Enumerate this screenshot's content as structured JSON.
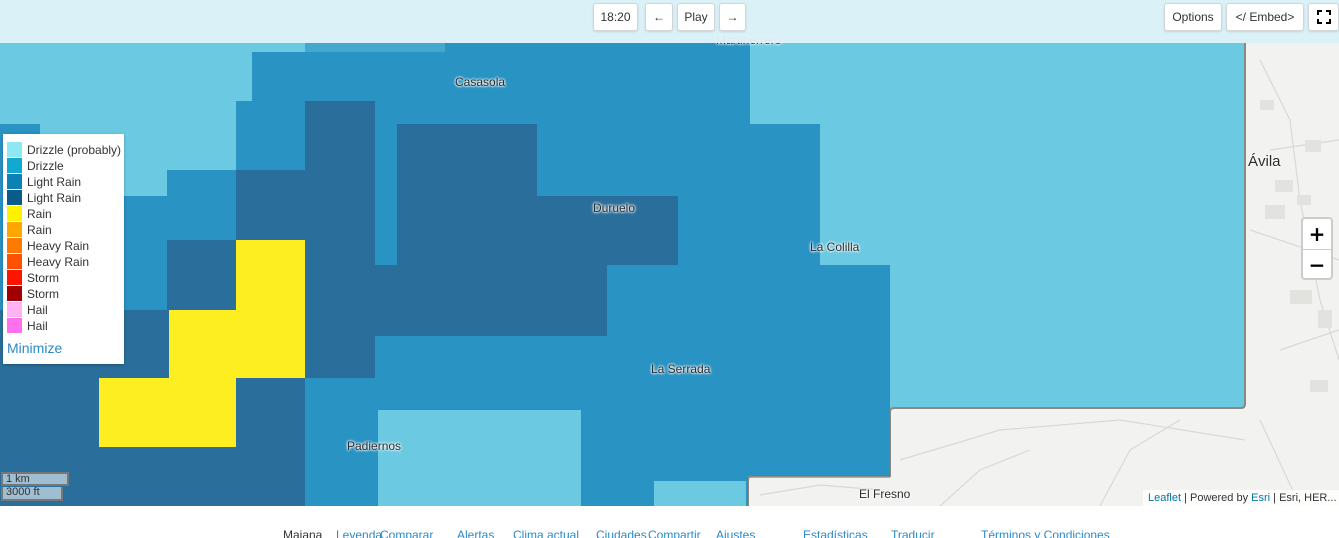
{
  "toolbar": {
    "time": "18:20",
    "prev_icon": "←",
    "play_label": "Play",
    "next_icon": "→",
    "options_label": "Options",
    "embed_label": "</ Embed>",
    "fullscreen_icon": "fullscreen-icon"
  },
  "map": {
    "places": {
      "martiherrero": "Martiherrero",
      "casasola": "Casasola",
      "duruelo": "Duruelo",
      "la_colilla": "La Colilla",
      "la_serrada": "La Serrada",
      "padiernos": "Padiernos",
      "el_fresno": "El Fresno",
      "avila": "Ávila"
    },
    "zoom_in": "+",
    "zoom_out": "−",
    "scale_km": "1 km",
    "scale_ft": "3000 ft",
    "attribution": {
      "leaflet": "Leaflet",
      "sep1": " | Powered by ",
      "esri": "Esri",
      "rest": " | Esri, HER..."
    },
    "colors": {
      "drizzle_area": "#6cc9e2",
      "light_rain": "#2993c4",
      "light_rain_dark": "#2a6f9b",
      "rain_yellow": "#fcee21"
    }
  },
  "legend": {
    "items": [
      {
        "label": "Drizzle (probably)",
        "color": "#8ee8f2"
      },
      {
        "label": "Drizzle",
        "color": "#11a9d1"
      },
      {
        "label": "Light Rain",
        "color": "#0b81b6"
      },
      {
        "label": "Light Rain",
        "color": "#0a5a8a"
      },
      {
        "label": "Rain",
        "color": "#fff200"
      },
      {
        "label": "Rain",
        "color": "#ffa500"
      },
      {
        "label": "Heavy Rain",
        "color": "#ff7a00"
      },
      {
        "label": "Heavy Rain",
        "color": "#ff5200"
      },
      {
        "label": "Storm",
        "color": "#ff1400"
      },
      {
        "label": "Storm",
        "color": "#a10000"
      },
      {
        "label": "Hail",
        "color": "#ffb3f5"
      },
      {
        "label": "Hail",
        "color": "#ff70ef"
      }
    ],
    "minimize_label": "Minimize"
  },
  "footer": {
    "links": [
      "Maiana",
      "Leyenda",
      "Comparar",
      "Alertas",
      "Clima actual",
      "Ciudades",
      "Compartir",
      "Ajustes",
      "Estadísticas",
      "Traducir",
      "Términos y Condiciones"
    ]
  }
}
